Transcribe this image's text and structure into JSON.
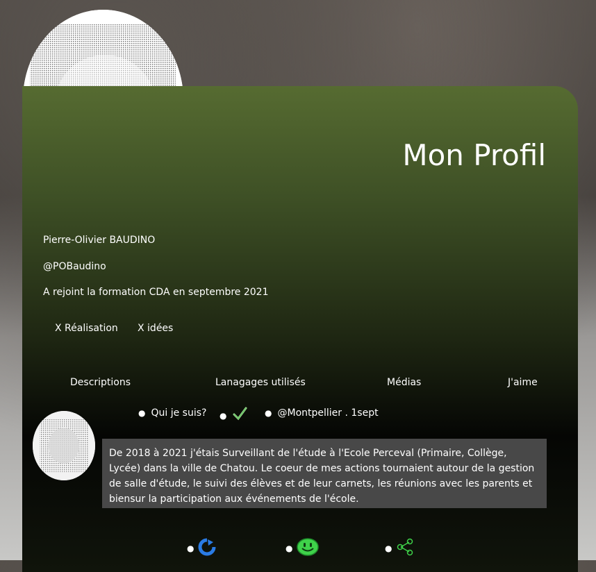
{
  "header": {
    "title": "Mon Profil"
  },
  "profile": {
    "name": "Pierre-Olivier BAUDINO",
    "handle": "@POBaudino",
    "joined": "A rejoint la formation CDA en septembre 2021"
  },
  "counters": {
    "realisations": "X Réalisation",
    "idees": "X idées"
  },
  "tabs": [
    "Descriptions",
    "Lanagages utilisés",
    "Médias",
    "J'aime"
  ],
  "post": {
    "title": "Qui je suis?",
    "check_icon": "check-icon",
    "location_date": "@Montpellier . 1sept",
    "text": "De 2018 à 2021 j'étais Surveillant de l'étude à l'Ecole Perceval (Primaire, Collège, Lycée) dans la ville de Chatou. Le coeur de mes actions tournaient autour de la gestion de salle d'étude, le suivi des élèves et de leur carnets, les réunions avec les parents et biensur la participation aux événements de l'école.",
    "actions": [
      "refresh-icon",
      "smiley-icon",
      "share-icon"
    ]
  },
  "colors": {
    "card_top": "#566b31",
    "card_bottom": "#050604",
    "desc_bg": "#484848",
    "accent_blue": "#2a7be4",
    "accent_green": "#3fd24a"
  }
}
